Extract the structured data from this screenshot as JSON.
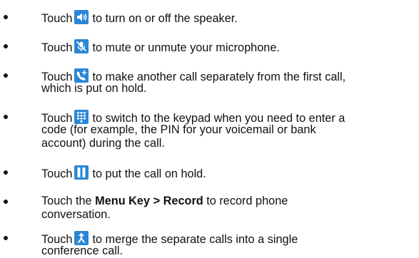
{
  "items": [
    {
      "lines": [
        {
          "pre": "Touch",
          "icon": "speaker-icon",
          "post": "to turn on or off the speaker."
        }
      ]
    },
    {
      "lines": [
        {
          "pre": "Touch",
          "icon": "microphone-mute-icon",
          "post": "to mute or unmute your microphone."
        }
      ]
    },
    {
      "lines": [
        {
          "pre": "Touch",
          "icon": "add-call-icon",
          "post": "to make another call separately from the first call,"
        },
        {
          "text": "which is put on hold."
        }
      ]
    },
    {
      "lines": [
        {
          "pre": "Touch",
          "icon": "keypad-icon",
          "post": "to switch to the keypad when you need to enter a"
        },
        {
          "text": "code (for example, the PIN for your voicemail or bank"
        },
        {
          "text": "account) during the call."
        }
      ]
    },
    {
      "lines": [
        {
          "pre": "Touch",
          "icon": "pause-icon",
          "post": "to put the call on hold."
        }
      ]
    },
    {
      "lines": [
        {
          "pre": "Touch the",
          "bold1": "Menu Key",
          "sep": ">",
          "bold2": "Record",
          "post": "to record phone"
        },
        {
          "text": "conversation."
        }
      ]
    },
    {
      "lines": [
        {
          "pre": "Touch",
          "icon": "merge-calls-icon",
          "post": "to merge the separate calls into a single"
        },
        {
          "text": "conference call."
        }
      ]
    }
  ],
  "colors": {
    "icon_bg": "#2a86d6",
    "icon_fg": "#ffffff",
    "text": "#111111"
  }
}
